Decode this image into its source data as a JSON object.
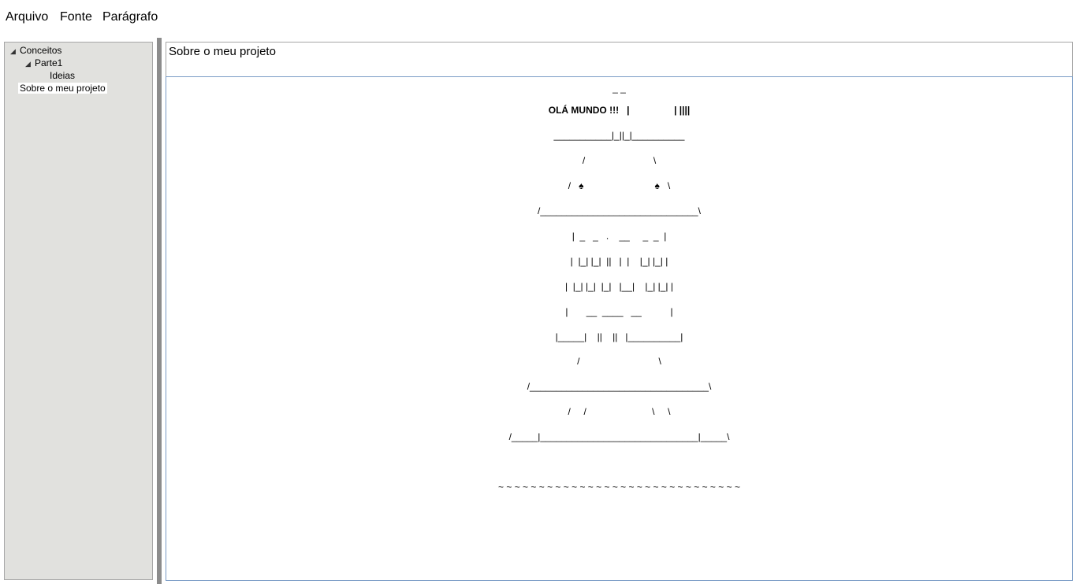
{
  "menu": {
    "items": [
      "Arquivo",
      "Fonte",
      "Parágrafo"
    ]
  },
  "tree": {
    "nodes": [
      {
        "label": "Conceitos",
        "expanded": true,
        "level": 0
      },
      {
        "label": "Parte1",
        "expanded": true,
        "level": 1
      },
      {
        "label": "Ideias",
        "level": 2
      },
      {
        "label": "Sobre o meu projeto",
        "level": 0,
        "selected": true
      }
    ]
  },
  "document": {
    "title": "Sobre o meu projeto",
    "art": [
      "_ _",
      "OLÁ MUNDO !!!   |                 | ||||",
      "___________|_||_|__________",
      "/                          \\",
      "/   ♠                           ♠   \\",
      "/______________________________\\",
      "|  _   _   .    __     _  _  |",
      "|  |_| |_|  ||   |  |    |_| |_| |",
      "|  |_| |_|  |_|   |__|    |_| |_| |",
      "|       __  ____   __           |",
      "|_____|    ||    ||   |__________|",
      "/                              \\",
      "/__________________________________\\",
      "/     /                         \\     \\",
      "/_____|______________________________|_____\\",
      "~ ~ ~ ~ ~ ~ ~ ~ ~ ~ ~ ~ ~ ~ ~ ~ ~ ~ ~ ~ ~ ~ ~ ~ ~ ~ ~ ~ ~ ~"
    ]
  }
}
